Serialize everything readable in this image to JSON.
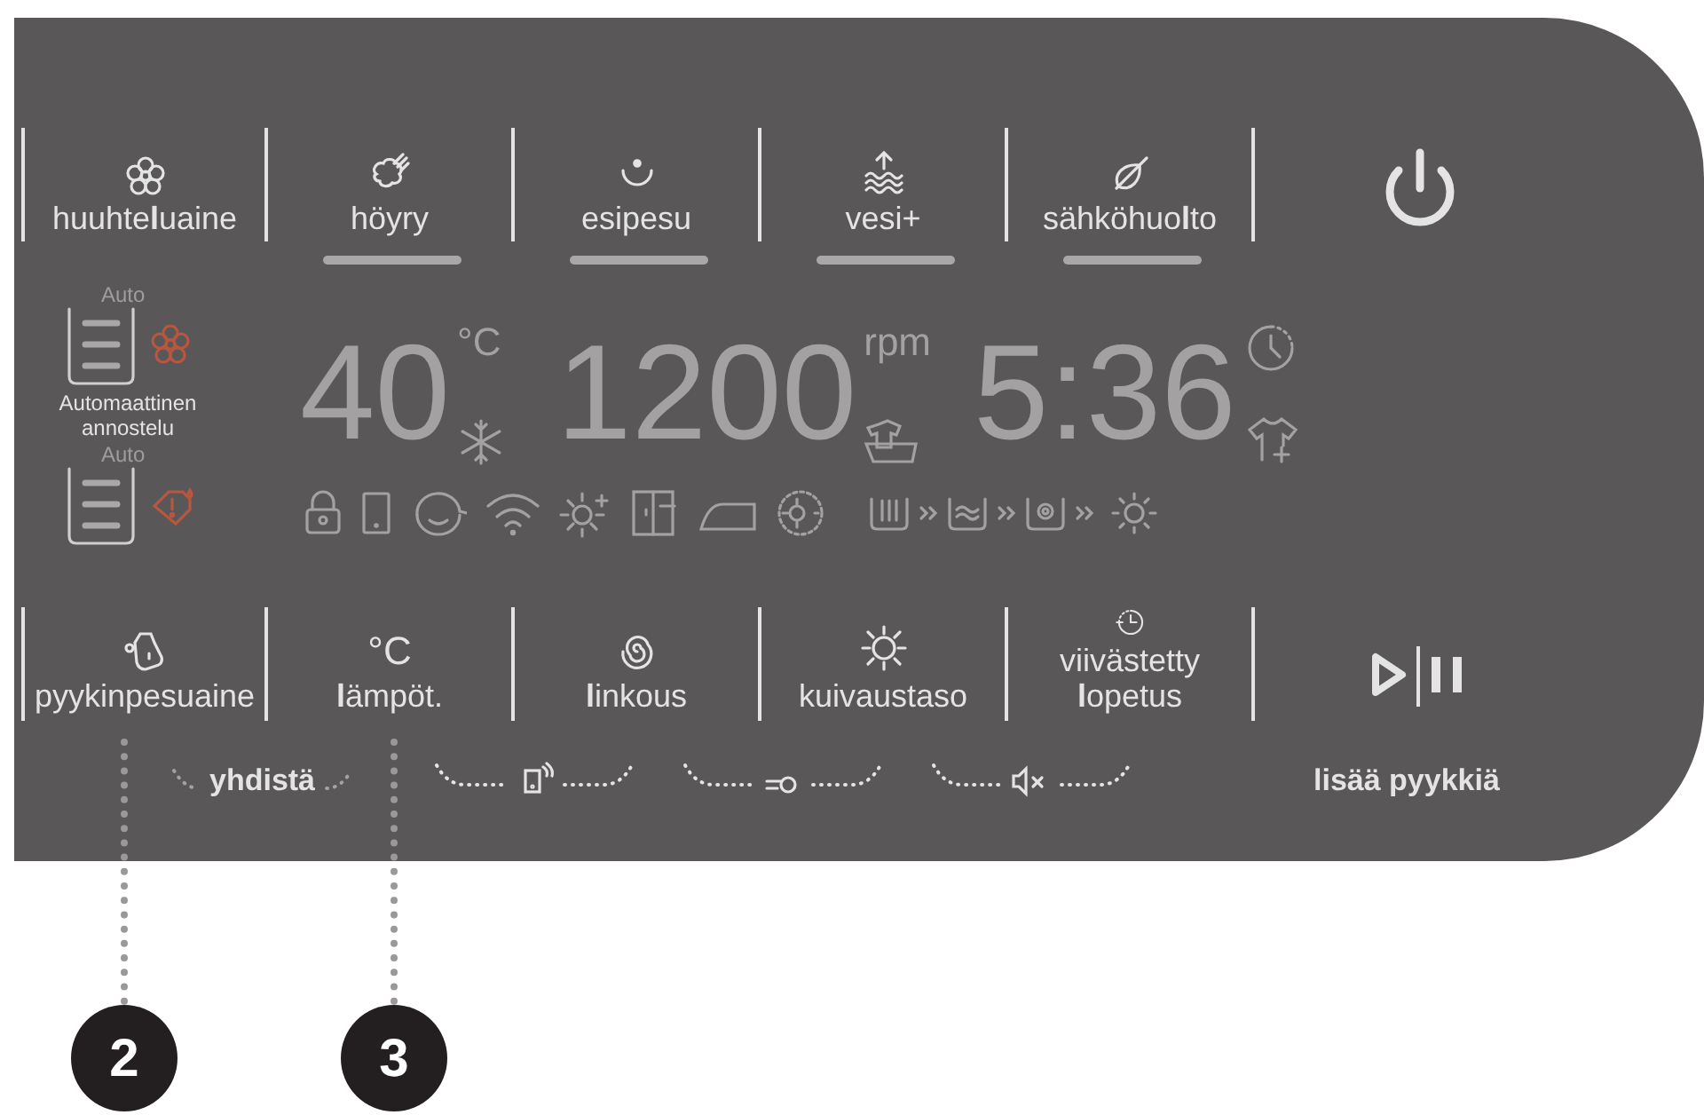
{
  "top_buttons": [
    {
      "label": "huuhte**l**uaine",
      "indicator": false
    },
    {
      "label": "höyry",
      "indicator": true
    },
    {
      "label": "esipesu",
      "indicator": true
    },
    {
      "label": "vesi+",
      "indicator": true
    },
    {
      "label": "sähköhuo**l**to",
      "indicator": true
    }
  ],
  "auto_dosing": {
    "top_label": "Auto",
    "caption": "Automaattinen annostelu",
    "bottom_label": "Auto"
  },
  "display": {
    "temperature": "40",
    "temperature_unit": "°C",
    "spin": "1200",
    "spin_unit": "rpm",
    "time": "5:36"
  },
  "bottom_buttons": [
    {
      "label": "pyykinpesuaine"
    },
    {
      "label": "**l**ämpöt.",
      "icon_text": "°C"
    },
    {
      "label": "**l**inkous"
    },
    {
      "label": "kuivaustaso"
    },
    {
      "label": "viivästetty\n**l**opetus"
    }
  ],
  "start_pause_caption": "lisää pyykkiä",
  "connect_hint": "yhdistä",
  "callouts": [
    "2",
    "3"
  ]
}
